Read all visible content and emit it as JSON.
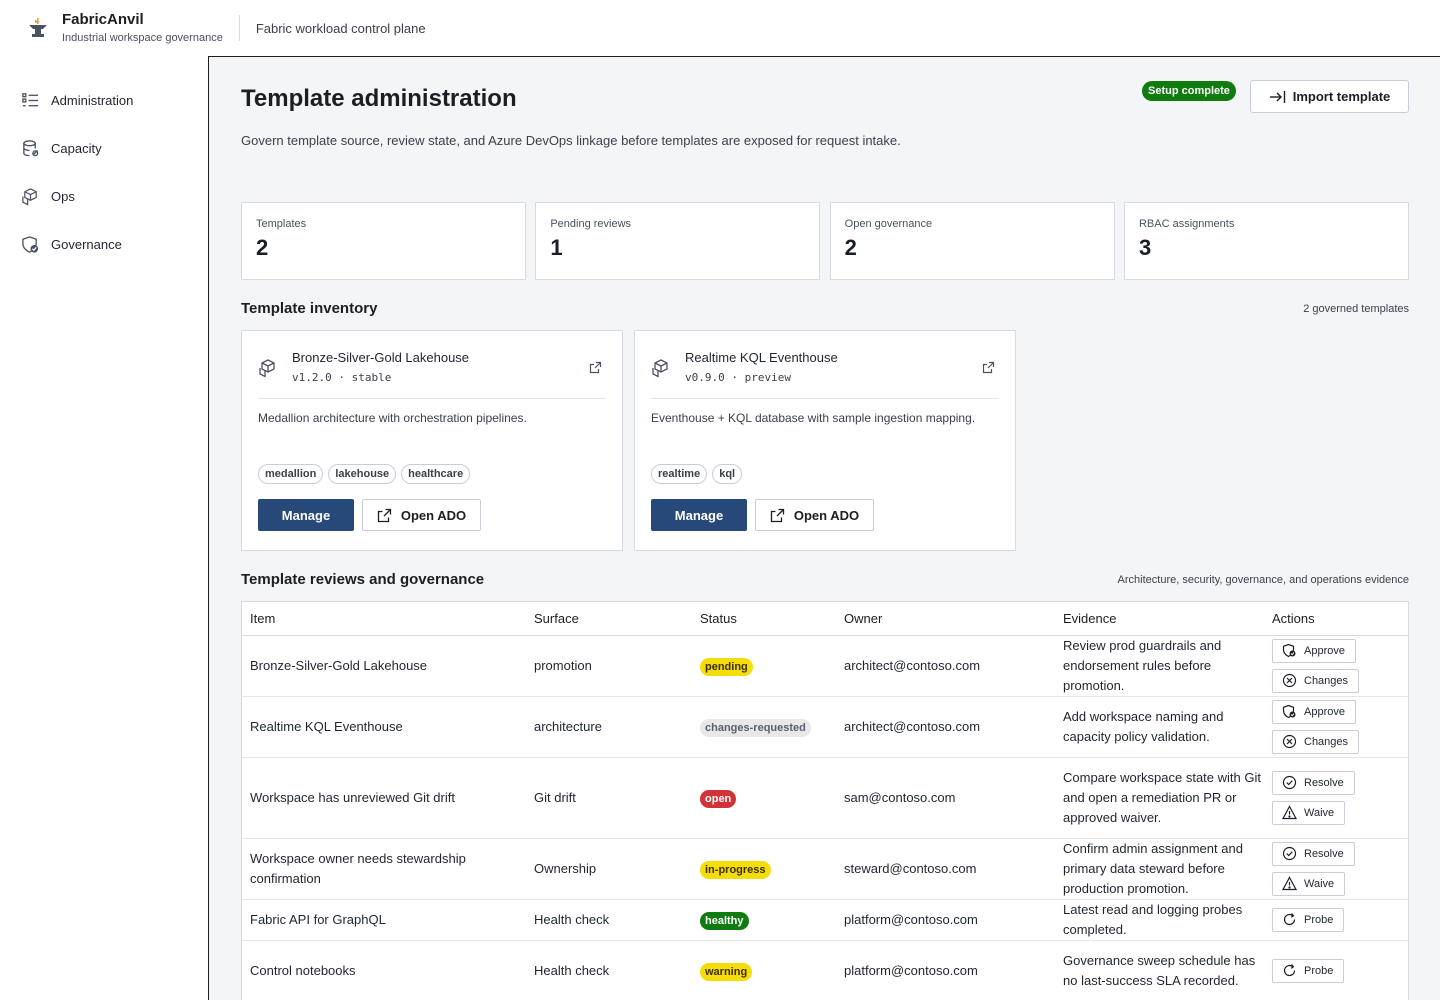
{
  "app": {
    "name": "FabricAnvil",
    "subtitle": "Industrial workspace governance",
    "plane": "Fabric workload control plane"
  },
  "sidebar": {
    "items": [
      {
        "label": "Administration",
        "icon": "list-icon"
      },
      {
        "label": "Capacity",
        "icon": "database-icon"
      },
      {
        "label": "Ops",
        "icon": "cubes-icon"
      },
      {
        "label": "Governance",
        "icon": "shield-check-icon"
      }
    ]
  },
  "page": {
    "title": "Template administration",
    "setup_badge": "Setup complete",
    "import_label": "Import template",
    "description": "Govern template source, review state, and Azure DevOps linkage before templates are exposed for request intake."
  },
  "metrics": [
    {
      "label": "Templates",
      "value": "2"
    },
    {
      "label": "Pending reviews",
      "value": "1"
    },
    {
      "label": "Open governance",
      "value": "2"
    },
    {
      "label": "RBAC assignments",
      "value": "3"
    }
  ],
  "inventory": {
    "title": "Template inventory",
    "note": "2 governed templates",
    "templates": [
      {
        "name": "Bronze-Silver-Gold Lakehouse",
        "version": "v1.2.0 · stable",
        "description": "Medallion architecture with orchestration pipelines.",
        "tags": [
          "medallion",
          "lakehouse",
          "healthcare"
        ],
        "manage_label": "Manage",
        "ado_label": "Open ADO"
      },
      {
        "name": "Realtime KQL Eventhouse",
        "version": "v0.9.0 · preview",
        "description": "Eventhouse + KQL database with sample ingestion mapping.",
        "tags": [
          "realtime",
          "kql"
        ],
        "manage_label": "Manage",
        "ado_label": "Open ADO"
      }
    ]
  },
  "reviews": {
    "title": "Template reviews and governance",
    "note": "Architecture, security, governance, and operations evidence",
    "columns": [
      "Item",
      "Surface",
      "Status",
      "Owner",
      "Evidence",
      "Actions"
    ],
    "rows": [
      {
        "item": "Bronze-Silver-Gold Lakehouse",
        "surface": "promotion",
        "status": "pending",
        "status_color": "#f5dc0b",
        "owner": "architect@contoso.com",
        "evidence": "Review prod guardrails and endorsement rules before promotion.",
        "actions": [
          "Approve",
          "Changes"
        ]
      },
      {
        "item": "Realtime KQL Eventhouse",
        "surface": "architecture",
        "status": "changes-requested",
        "status_color": "#e8e8e8",
        "owner": "architect@contoso.com",
        "evidence": "Add workspace naming and capacity policy validation.",
        "actions": [
          "Approve",
          "Changes"
        ]
      },
      {
        "item": "Workspace has unreviewed Git drift",
        "surface": "Git drift",
        "status": "open",
        "status_color": "#d13438",
        "owner": "sam@contoso.com",
        "evidence": "Compare workspace state with Git and open a remediation PR or approved waiver.",
        "actions": [
          "Resolve",
          "Waive"
        ]
      },
      {
        "item": "Workspace owner needs stewardship confirmation",
        "surface": "Ownership",
        "status": "in-progress",
        "status_color": "#f5dc0b",
        "owner": "steward@contoso.com",
        "evidence": "Confirm admin assignment and primary data steward before production promotion.",
        "actions": [
          "Resolve",
          "Waive"
        ]
      },
      {
        "item": "Fabric API for GraphQL",
        "surface": "Health check",
        "status": "healthy",
        "status_color": "#107c10",
        "owner": "platform@contoso.com",
        "evidence": "Latest read and logging probes completed.",
        "actions": [
          "Probe"
        ]
      },
      {
        "item": "Control notebooks",
        "surface": "Health check",
        "status": "warning",
        "status_color": "#f5dc0b",
        "owner": "platform@contoso.com",
        "evidence": "Governance sweep schedule has no last-success SLA recorded.",
        "actions": [
          "Probe"
        ]
      }
    ]
  }
}
